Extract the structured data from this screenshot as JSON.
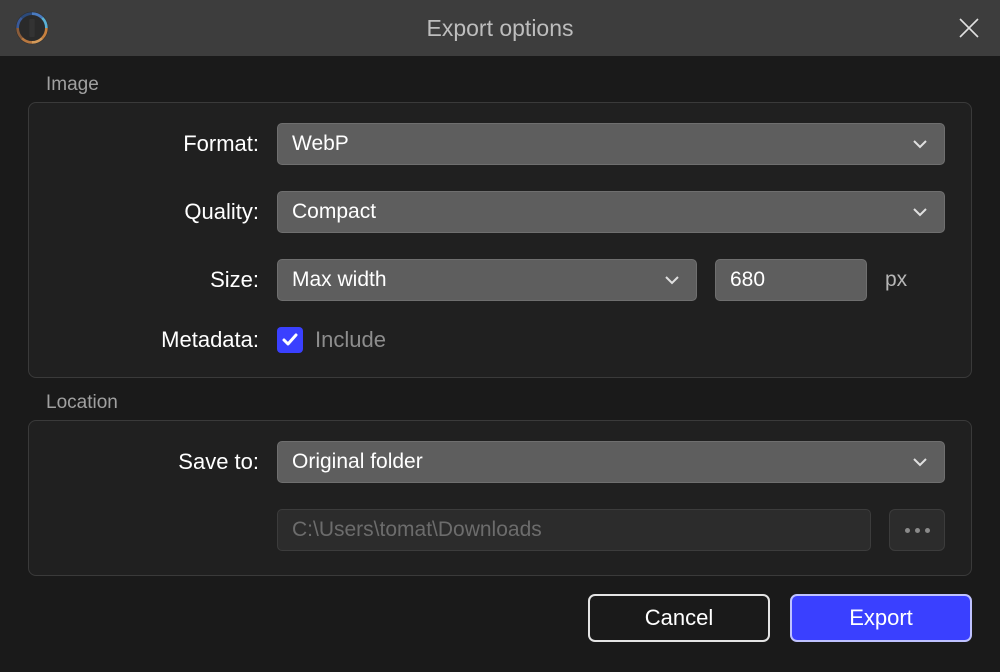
{
  "title": "Export options",
  "sections": {
    "image": {
      "label": "Image",
      "format_label": "Format:",
      "format_value": "WebP",
      "quality_label": "Quality:",
      "quality_value": "Compact",
      "size_label": "Size:",
      "size_mode": "Max width",
      "size_value": "680",
      "size_unit": "px",
      "metadata_label": "Metadata:",
      "metadata_include": "Include"
    },
    "location": {
      "label": "Location",
      "saveto_label": "Save to:",
      "saveto_value": "Original folder",
      "path_value": "C:\\Users\\tomat\\Downloads"
    }
  },
  "buttons": {
    "cancel": "Cancel",
    "export": "Export"
  }
}
